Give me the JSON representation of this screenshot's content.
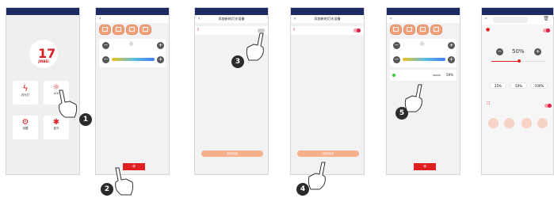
{
  "status": {
    "left": "",
    "right": ""
  },
  "screen1": {
    "logo_text": "JINBEI",
    "tiles": [
      {
        "label": "闪光灯"
      },
      {
        "label": "LED"
      },
      {
        "label": "设置"
      },
      {
        "label": "蓝牙"
      }
    ]
  },
  "screen2": {
    "add": "+"
  },
  "screen3": {
    "title": "添加新的灯光设备",
    "device": "",
    "footer": "添加完成"
  },
  "screen4": {
    "title": "添加新的灯光设备",
    "device": "",
    "footer": "添加完成"
  },
  "screen5": {
    "add": "+",
    "device": "",
    "temp": "5600K",
    "pct": "59%"
  },
  "screen6": {
    "pct": "50%",
    "presets": [
      "25%",
      "50%",
      "100%"
    ]
  },
  "badges": [
    "1",
    "2",
    "3",
    "4",
    "5"
  ]
}
